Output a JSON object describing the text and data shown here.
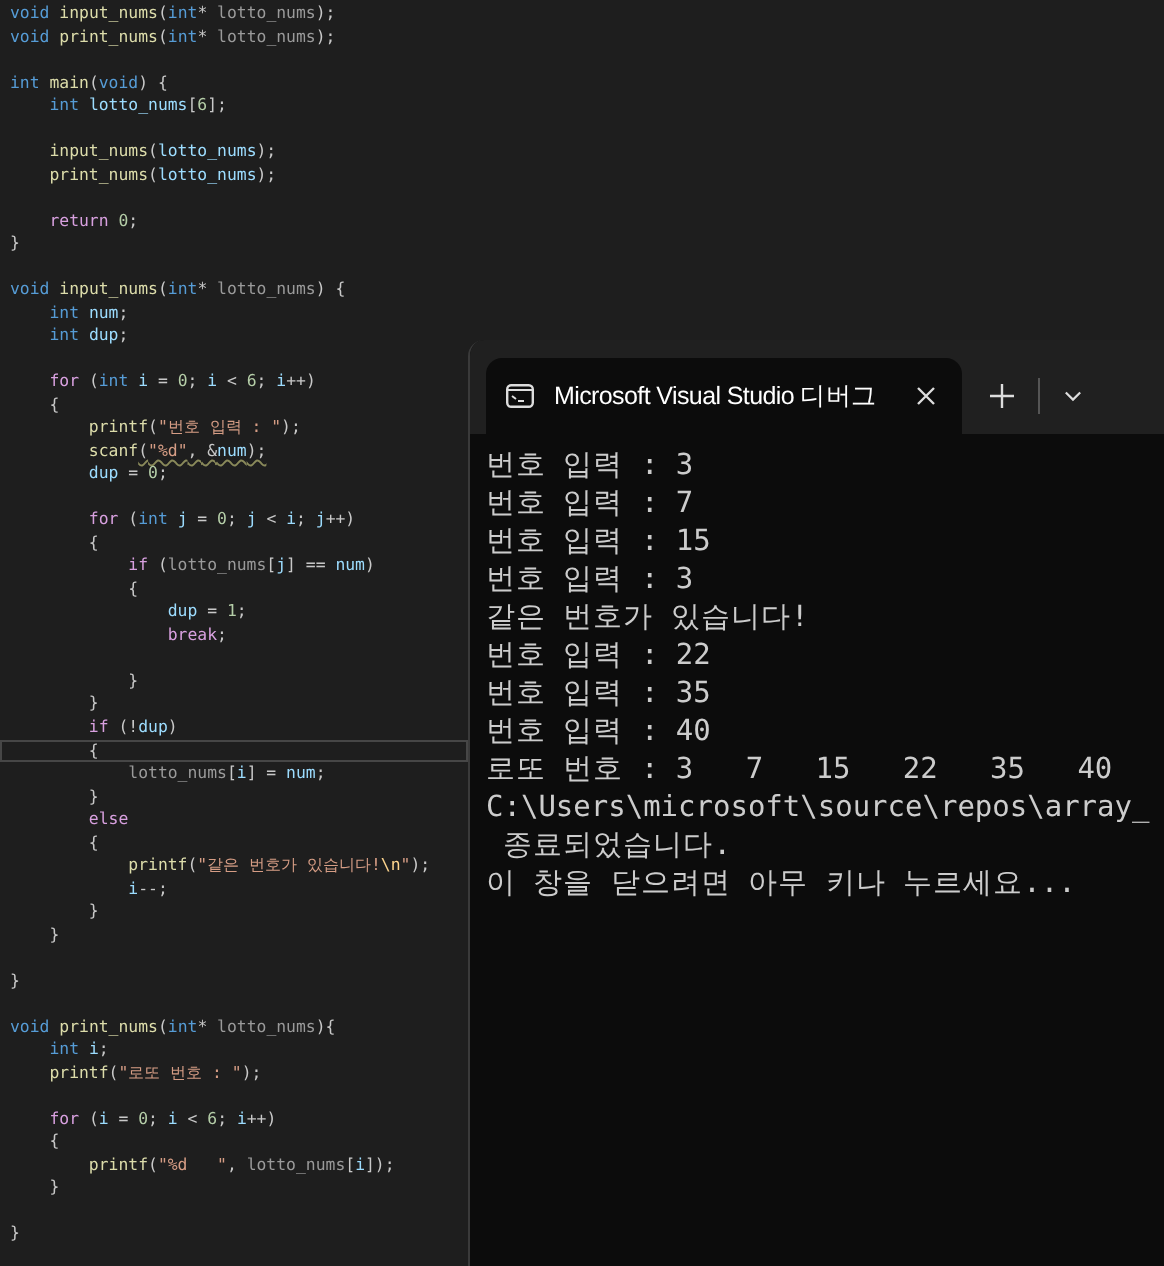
{
  "editor": {
    "lines": [
      {
        "kind": "code",
        "tokens": [
          {
            "text": "void ",
            "kind": "k"
          },
          {
            "text": "input_nums",
            "kind": "f"
          },
          {
            "text": "(",
            "kind": "t"
          },
          {
            "text": "int",
            "kind": "k"
          },
          {
            "text": "* ",
            "kind": "t"
          },
          {
            "text": "lotto_nums",
            "kind": "p"
          },
          {
            "text": ");",
            "kind": "t"
          }
        ]
      },
      {
        "kind": "code",
        "tokens": [
          {
            "text": "void ",
            "kind": "k"
          },
          {
            "text": "print_nums",
            "kind": "f"
          },
          {
            "text": "(",
            "kind": "t"
          },
          {
            "text": "int",
            "kind": "k"
          },
          {
            "text": "* ",
            "kind": "t"
          },
          {
            "text": "lotto_nums",
            "kind": "p"
          },
          {
            "text": ");",
            "kind": "t"
          }
        ]
      },
      {
        "kind": "blank"
      },
      {
        "kind": "code",
        "tokens": [
          {
            "text": "int ",
            "kind": "k"
          },
          {
            "text": "main",
            "kind": "f"
          },
          {
            "text": "(",
            "kind": "t"
          },
          {
            "text": "void",
            "kind": "k"
          },
          {
            "text": ") {",
            "kind": "t"
          }
        ]
      },
      {
        "kind": "code",
        "tokens": [
          {
            "text": "    int ",
            "kind": "k"
          },
          {
            "text": "lotto_nums",
            "kind": "v"
          },
          {
            "text": "[",
            "kind": "t"
          },
          {
            "text": "6",
            "kind": "n"
          },
          {
            "text": "];",
            "kind": "t"
          }
        ]
      },
      {
        "kind": "blank"
      },
      {
        "kind": "code",
        "tokens": [
          {
            "text": "    input_nums",
            "kind": "f"
          },
          {
            "text": "(",
            "kind": "t"
          },
          {
            "text": "lotto_nums",
            "kind": "v"
          },
          {
            "text": ");",
            "kind": "t"
          }
        ]
      },
      {
        "kind": "code",
        "tokens": [
          {
            "text": "    print_nums",
            "kind": "f"
          },
          {
            "text": "(",
            "kind": "t"
          },
          {
            "text": "lotto_nums",
            "kind": "v"
          },
          {
            "text": ");",
            "kind": "t"
          }
        ]
      },
      {
        "kind": "blank"
      },
      {
        "kind": "code",
        "tokens": [
          {
            "text": "    return ",
            "kind": "c"
          },
          {
            "text": "0",
            "kind": "n"
          },
          {
            "text": ";",
            "kind": "t"
          }
        ]
      },
      {
        "kind": "code",
        "tokens": [
          {
            "text": "}",
            "kind": "t"
          }
        ]
      },
      {
        "kind": "blank"
      },
      {
        "kind": "code",
        "tokens": [
          {
            "text": "void ",
            "kind": "k"
          },
          {
            "text": "input_nums",
            "kind": "f"
          },
          {
            "text": "(",
            "kind": "t"
          },
          {
            "text": "int",
            "kind": "k"
          },
          {
            "text": "* ",
            "kind": "t"
          },
          {
            "text": "lotto_nums",
            "kind": "p"
          },
          {
            "text": ") {",
            "kind": "t"
          }
        ]
      },
      {
        "kind": "code",
        "tokens": [
          {
            "text": "    int ",
            "kind": "k"
          },
          {
            "text": "num",
            "kind": "v"
          },
          {
            "text": ";",
            "kind": "t"
          }
        ]
      },
      {
        "kind": "code",
        "tokens": [
          {
            "text": "    int ",
            "kind": "k"
          },
          {
            "text": "dup",
            "kind": "v"
          },
          {
            "text": ";",
            "kind": "t"
          }
        ]
      },
      {
        "kind": "blank"
      },
      {
        "kind": "code",
        "tokens": [
          {
            "text": "    for",
            "kind": "c"
          },
          {
            "text": " (",
            "kind": "t"
          },
          {
            "text": "int ",
            "kind": "k"
          },
          {
            "text": "i",
            "kind": "v"
          },
          {
            "text": " = ",
            "kind": "t"
          },
          {
            "text": "0",
            "kind": "n"
          },
          {
            "text": "; ",
            "kind": "t"
          },
          {
            "text": "i",
            "kind": "v"
          },
          {
            "text": " < ",
            "kind": "t"
          },
          {
            "text": "6",
            "kind": "n"
          },
          {
            "text": "; ",
            "kind": "t"
          },
          {
            "text": "i",
            "kind": "v"
          },
          {
            "text": "++)",
            "kind": "t"
          }
        ]
      },
      {
        "kind": "code",
        "tokens": [
          {
            "text": "    {",
            "kind": "t"
          }
        ]
      },
      {
        "kind": "code",
        "tokens": [
          {
            "text": "        printf",
            "kind": "f"
          },
          {
            "text": "(",
            "kind": "t"
          },
          {
            "text": "\"번호 입력 : \"",
            "kind": "s"
          },
          {
            "text": ");",
            "kind": "t"
          }
        ]
      },
      {
        "kind": "code",
        "warning": true,
        "tokens": [
          {
            "text": "        scanf",
            "kind": "f"
          },
          {
            "text": "(",
            "kind": "t"
          },
          {
            "text": "\"%d\"",
            "kind": "s"
          },
          {
            "text": ", &",
            "kind": "t"
          },
          {
            "text": "num",
            "kind": "v"
          },
          {
            "text": ");",
            "kind": "t"
          }
        ]
      },
      {
        "kind": "code",
        "tokens": [
          {
            "text": "        dup",
            "kind": "v"
          },
          {
            "text": " = ",
            "kind": "t"
          },
          {
            "text": "0",
            "kind": "n"
          },
          {
            "text": ";",
            "kind": "t"
          }
        ]
      },
      {
        "kind": "blank"
      },
      {
        "kind": "code",
        "tokens": [
          {
            "text": "        for",
            "kind": "c"
          },
          {
            "text": " (",
            "kind": "t"
          },
          {
            "text": "int ",
            "kind": "k"
          },
          {
            "text": "j",
            "kind": "v"
          },
          {
            "text": " = ",
            "kind": "t"
          },
          {
            "text": "0",
            "kind": "n"
          },
          {
            "text": "; ",
            "kind": "t"
          },
          {
            "text": "j",
            "kind": "v"
          },
          {
            "text": " < ",
            "kind": "t"
          },
          {
            "text": "i",
            "kind": "v"
          },
          {
            "text": "; ",
            "kind": "t"
          },
          {
            "text": "j",
            "kind": "v"
          },
          {
            "text": "++)",
            "kind": "t"
          }
        ]
      },
      {
        "kind": "code",
        "tokens": [
          {
            "text": "        {",
            "kind": "t"
          }
        ]
      },
      {
        "kind": "code",
        "tokens": [
          {
            "text": "            if",
            "kind": "c"
          },
          {
            "text": " (",
            "kind": "t"
          },
          {
            "text": "lotto_nums",
            "kind": "p"
          },
          {
            "text": "[",
            "kind": "t"
          },
          {
            "text": "j",
            "kind": "v"
          },
          {
            "text": "] == ",
            "kind": "t"
          },
          {
            "text": "num",
            "kind": "v"
          },
          {
            "text": ")",
            "kind": "t"
          }
        ]
      },
      {
        "kind": "code",
        "tokens": [
          {
            "text": "            {",
            "kind": "t"
          }
        ]
      },
      {
        "kind": "code",
        "tokens": [
          {
            "text": "                dup",
            "kind": "v"
          },
          {
            "text": " = ",
            "kind": "t"
          },
          {
            "text": "1",
            "kind": "n"
          },
          {
            "text": ";",
            "kind": "t"
          }
        ]
      },
      {
        "kind": "code",
        "tokens": [
          {
            "text": "                break",
            "kind": "c"
          },
          {
            "text": ";",
            "kind": "t"
          }
        ]
      },
      {
        "kind": "blank"
      },
      {
        "kind": "code",
        "tokens": [
          {
            "text": "            }",
            "kind": "t"
          }
        ]
      },
      {
        "kind": "code",
        "tokens": [
          {
            "text": "        }",
            "kind": "t"
          }
        ]
      },
      {
        "kind": "code",
        "tokens": [
          {
            "text": "        if",
            "kind": "c"
          },
          {
            "text": " (!",
            "kind": "t"
          },
          {
            "text": "dup",
            "kind": "v"
          },
          {
            "text": ")",
            "kind": "t"
          }
        ]
      },
      {
        "kind": "code",
        "current": true,
        "tokens": [
          {
            "text": "        {",
            "kind": "t"
          }
        ]
      },
      {
        "kind": "code",
        "tokens": [
          {
            "text": "            lotto_nums",
            "kind": "p"
          },
          {
            "text": "[",
            "kind": "t"
          },
          {
            "text": "i",
            "kind": "v"
          },
          {
            "text": "] = ",
            "kind": "t"
          },
          {
            "text": "num",
            "kind": "v"
          },
          {
            "text": ";",
            "kind": "t"
          }
        ]
      },
      {
        "kind": "code",
        "tokens": [
          {
            "text": "        }",
            "kind": "t"
          }
        ]
      },
      {
        "kind": "code",
        "tokens": [
          {
            "text": "        else",
            "kind": "c"
          }
        ]
      },
      {
        "kind": "code",
        "tokens": [
          {
            "text": "        {",
            "kind": "t"
          }
        ]
      },
      {
        "kind": "code",
        "tokens": [
          {
            "text": "            printf",
            "kind": "f"
          },
          {
            "text": "(",
            "kind": "t"
          },
          {
            "text": "\"같은 번호가 있습니다!",
            "kind": "s"
          },
          {
            "text": "\\n",
            "kind": "e"
          },
          {
            "text": "\"",
            "kind": "s"
          },
          {
            "text": ");",
            "kind": "t"
          }
        ]
      },
      {
        "kind": "code",
        "tokens": [
          {
            "text": "            i",
            "kind": "v"
          },
          {
            "text": "--;",
            "kind": "t"
          }
        ]
      },
      {
        "kind": "code",
        "tokens": [
          {
            "text": "        }",
            "kind": "t"
          }
        ]
      },
      {
        "kind": "code",
        "tokens": [
          {
            "text": "    }",
            "kind": "t"
          }
        ]
      },
      {
        "kind": "blank"
      },
      {
        "kind": "code",
        "tokens": [
          {
            "text": "}",
            "kind": "t"
          }
        ]
      },
      {
        "kind": "blank"
      },
      {
        "kind": "code",
        "tokens": [
          {
            "text": "void ",
            "kind": "k"
          },
          {
            "text": "print_nums",
            "kind": "f"
          },
          {
            "text": "(",
            "kind": "t"
          },
          {
            "text": "int",
            "kind": "k"
          },
          {
            "text": "* ",
            "kind": "t"
          },
          {
            "text": "lotto_nums",
            "kind": "p"
          },
          {
            "text": "){",
            "kind": "t"
          }
        ]
      },
      {
        "kind": "code",
        "tokens": [
          {
            "text": "    int ",
            "kind": "k"
          },
          {
            "text": "i",
            "kind": "v"
          },
          {
            "text": ";",
            "kind": "t"
          }
        ]
      },
      {
        "kind": "code",
        "tokens": [
          {
            "text": "    printf",
            "kind": "f"
          },
          {
            "text": "(",
            "kind": "t"
          },
          {
            "text": "\"로또 번호 : \"",
            "kind": "s"
          },
          {
            "text": ");",
            "kind": "t"
          }
        ]
      },
      {
        "kind": "blank"
      },
      {
        "kind": "code",
        "tokens": [
          {
            "text": "    for",
            "kind": "c"
          },
          {
            "text": " (",
            "kind": "t"
          },
          {
            "text": "i",
            "kind": "v"
          },
          {
            "text": " = ",
            "kind": "t"
          },
          {
            "text": "0",
            "kind": "n"
          },
          {
            "text": "; ",
            "kind": "t"
          },
          {
            "text": "i",
            "kind": "v"
          },
          {
            "text": " < ",
            "kind": "t"
          },
          {
            "text": "6",
            "kind": "n"
          },
          {
            "text": "; ",
            "kind": "t"
          },
          {
            "text": "i",
            "kind": "v"
          },
          {
            "text": "++)",
            "kind": "t"
          }
        ]
      },
      {
        "kind": "code",
        "tokens": [
          {
            "text": "    {",
            "kind": "t"
          }
        ]
      },
      {
        "kind": "code",
        "tokens": [
          {
            "text": "        printf",
            "kind": "f"
          },
          {
            "text": "(",
            "kind": "t"
          },
          {
            "text": "\"%d   \"",
            "kind": "s"
          },
          {
            "text": ", ",
            "kind": "t"
          },
          {
            "text": "lotto_nums",
            "kind": "p"
          },
          {
            "text": "[",
            "kind": "t"
          },
          {
            "text": "i",
            "kind": "v"
          },
          {
            "text": "]);",
            "kind": "t"
          }
        ]
      },
      {
        "kind": "code",
        "tokens": [
          {
            "text": "    }",
            "kind": "t"
          }
        ]
      },
      {
        "kind": "blank"
      },
      {
        "kind": "code",
        "tokens": [
          {
            "text": "}",
            "kind": "t"
          }
        ]
      }
    ]
  },
  "terminal": {
    "tab_title": "Microsoft Visual Studio 디버그",
    "lines": [
      "번호 입력 : 3",
      "번호 입력 : 7",
      "번호 입력 : 15",
      "번호 입력 : 3",
      "같은 번호가 있습니다!",
      "번호 입력 : 22",
      "번호 입력 : 35",
      "번호 입력 : 40",
      "로또 번호 : 3   7   15   22   35   40",
      "C:\\Users\\microsoft\\source\\repos\\array_",
      " 종료되었습니다.",
      "이 창을 닫으려면 아무 키나 누르세요..."
    ]
  }
}
